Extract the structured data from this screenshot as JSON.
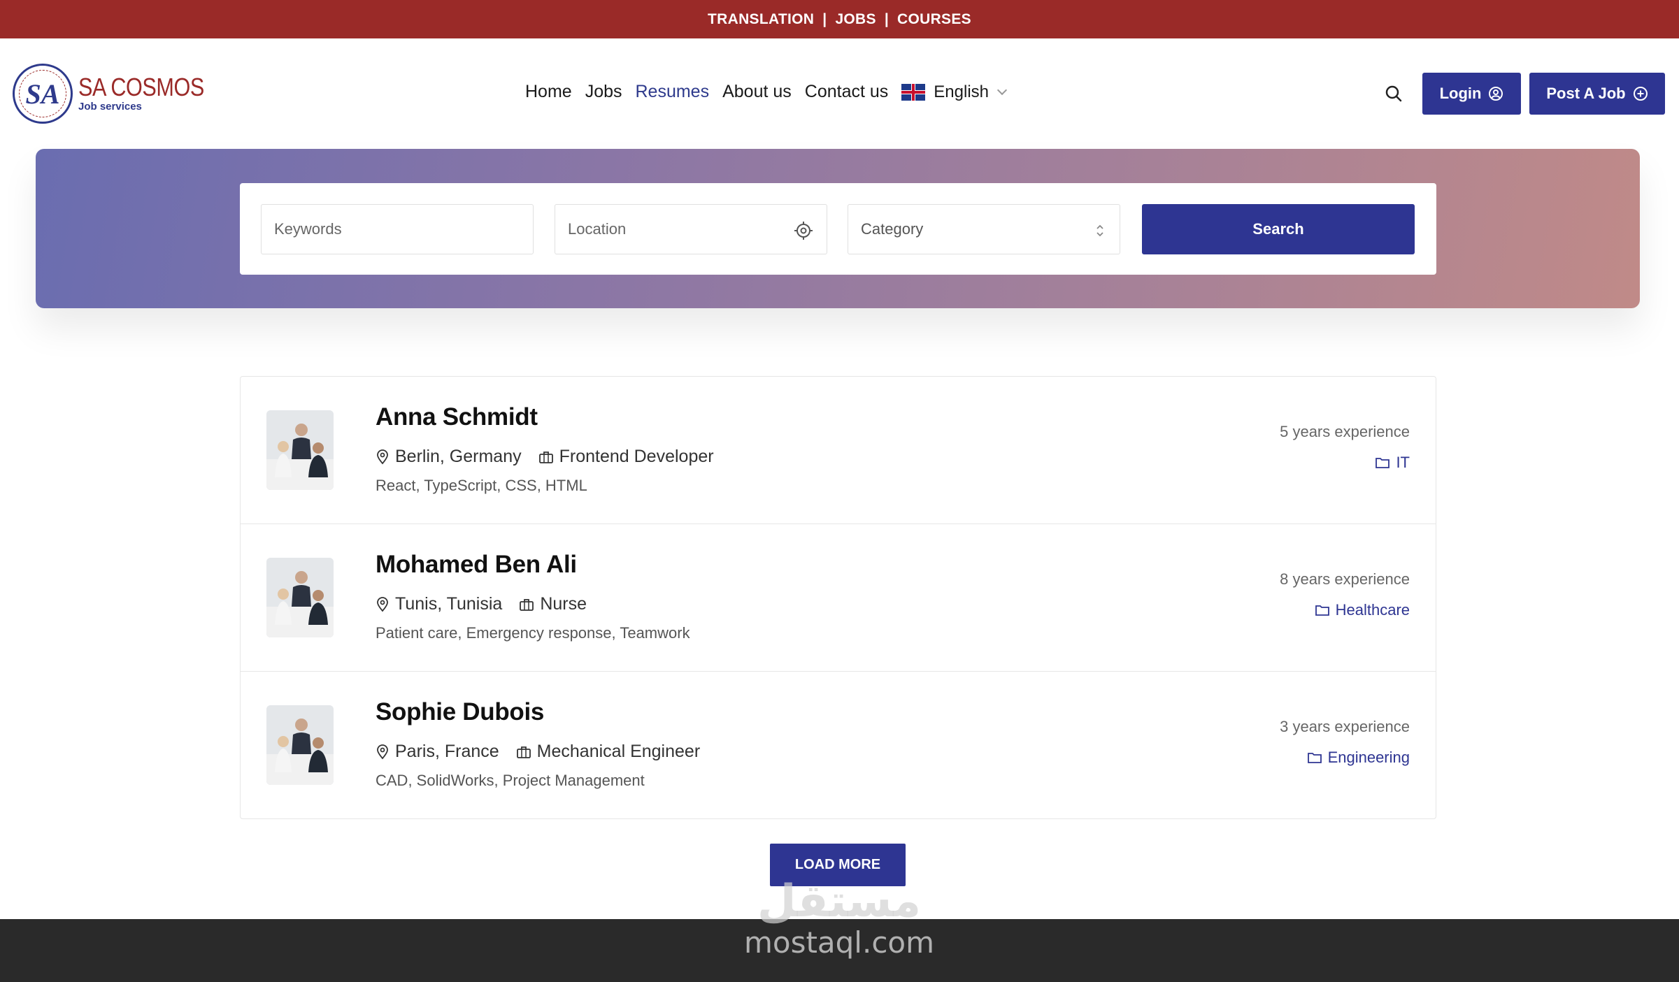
{
  "topbar": {
    "items": [
      "TRANSLATION",
      "JOBS",
      "COURSES"
    ],
    "separator": "|"
  },
  "brand": {
    "seal_text": "SA",
    "name": "SA COSMOS",
    "tagline": "Job services"
  },
  "nav": {
    "items": [
      {
        "label": "Home",
        "active": false
      },
      {
        "label": "Jobs",
        "active": false
      },
      {
        "label": "Resumes",
        "active": true
      },
      {
        "label": "About us",
        "active": false
      },
      {
        "label": "Contact us",
        "active": false
      }
    ],
    "language": "English"
  },
  "header_actions": {
    "login_label": "Login",
    "post_job_label": "Post A Job"
  },
  "search": {
    "keywords_placeholder": "Keywords",
    "location_placeholder": "Location",
    "category_placeholder": "Category",
    "button_label": "Search"
  },
  "resumes": [
    {
      "name": "Anna Schmidt",
      "location": "Berlin, Germany",
      "position": "Frontend Developer",
      "skills": "React, TypeScript, CSS, HTML",
      "experience": "5 years experience",
      "category": "IT"
    },
    {
      "name": "Mohamed Ben Ali",
      "location": "Tunis, Tunisia",
      "position": "Nurse",
      "skills": "Patient care, Emergency response, Teamwork",
      "experience": "8 years experience",
      "category": "Healthcare"
    },
    {
      "name": "Sophie Dubois",
      "location": "Paris, France",
      "position": "Mechanical Engineer",
      "skills": "CAD, SolidWorks, Project Management",
      "experience": "3 years experience",
      "category": "Engineering"
    }
  ],
  "load_more_label": "LOAD MORE",
  "watermark": {
    "arabic": "مستقل",
    "latin": "mostaql.com"
  },
  "colors": {
    "topbar": "#9a2a28",
    "primary": "#2e3592",
    "footer": "#2a2a2a"
  }
}
